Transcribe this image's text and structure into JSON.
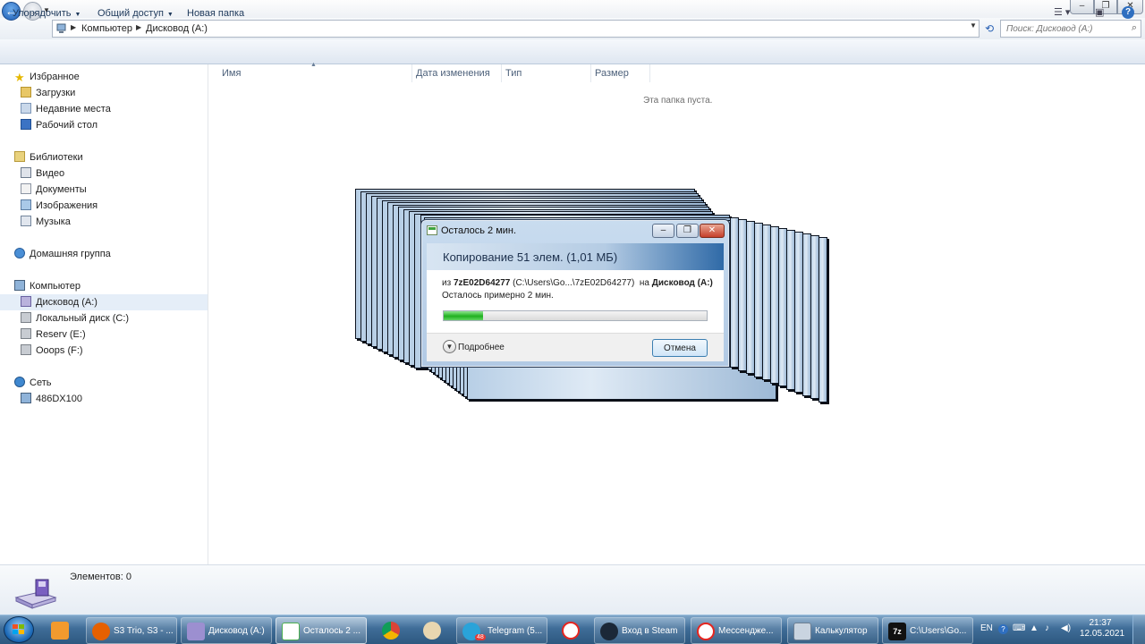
{
  "window": {
    "controls": {
      "min": "–",
      "max": "❐",
      "close": "✕"
    }
  },
  "address": {
    "crumbs": [
      "Компьютер",
      "Дисковод (A:)"
    ],
    "search_placeholder": "Поиск: Дисковод (A:)"
  },
  "toolbar": {
    "organize": "Упорядочить",
    "share": "Общий доступ",
    "new_folder": "Новая папка"
  },
  "sidebar": {
    "favorites": {
      "label": "Избранное",
      "items": [
        "Загрузки",
        "Недавние места",
        "Рабочий стол"
      ]
    },
    "libraries": {
      "label": "Библиотеки",
      "items": [
        "Видео",
        "Документы",
        "Изображения",
        "Музыка"
      ]
    },
    "homegroup": "Домашняя группа",
    "computer": {
      "label": "Компьютер",
      "items": [
        "Дисковод (A:)",
        "Локальный диск (C:)",
        "Reserv (E:)",
        "Ooops (F:)"
      ],
      "selected": "Дисковод (A:)"
    },
    "network": {
      "label": "Сеть",
      "items": [
        "486DX100"
      ]
    }
  },
  "content": {
    "columns": [
      "Имя",
      "Дата изменения",
      "Тип",
      "Размер"
    ],
    "empty_text": "Эта папка пуста."
  },
  "dialog": {
    "title": "Осталось 2 мин.",
    "heading": "Копирование 51 элем. (1,01 МБ)",
    "from_prefix": "из",
    "from_name": "7zE02D64277",
    "from_path": "(C:\\Users\\Go...\\7zE02D64277)",
    "to_prefix": "на",
    "to_name": "Дисковод (A:)",
    "remaining": "Осталось примерно 2 мин.",
    "progress": 0.15,
    "more": "Подробнее",
    "cancel": "Отмена"
  },
  "details": {
    "count": "Элементов: 0"
  },
  "taskbar": {
    "items": [
      {
        "label": "S3 Trio, S3 - ...",
        "icon": "firefox-icon",
        "color": "#e66000"
      },
      {
        "label": "Дисковод (A:)",
        "icon": "drive-icon",
        "color": "#9c8fd0"
      },
      {
        "label": "Осталось 2 ...",
        "icon": "copy-icon",
        "color": "#4caf50"
      },
      {
        "label": "Telegram (5...",
        "icon": "telegram-icon",
        "color": "#2aa3d9"
      },
      {
        "label": "Вход в Steam",
        "icon": "steam-icon",
        "color": "#1b2838"
      },
      {
        "label": "Мессендже...",
        "icon": "yandex-icon",
        "color": "#e52620"
      },
      {
        "label": "Калькулятор",
        "icon": "calculator-icon",
        "color": "#a9b8c8"
      },
      {
        "label": "C:\\Users\\Go...",
        "icon": "7zip-icon",
        "color": "#111111"
      }
    ],
    "telegram_badge": "48",
    "tray": {
      "lang": "EN",
      "time": "21:37",
      "date": "12.05.2021"
    }
  }
}
